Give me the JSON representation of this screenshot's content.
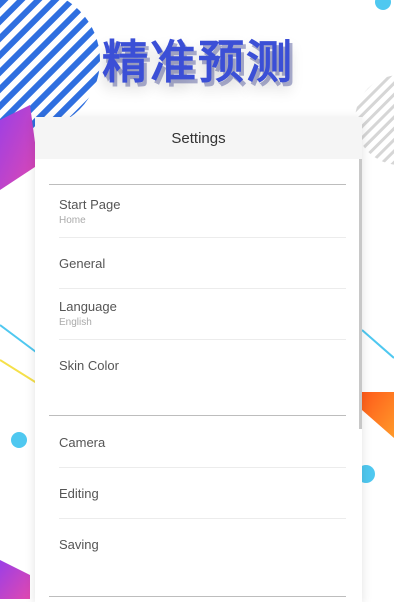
{
  "banner": {
    "title": "精准预测"
  },
  "settings": {
    "title": "Settings",
    "items": [
      {
        "label": "Start Page",
        "value": "Home"
      },
      {
        "label": "General"
      },
      {
        "label": "Language",
        "value": "English"
      },
      {
        "label": "Skin Color"
      },
      {
        "label": "Camera"
      },
      {
        "label": "Editing"
      },
      {
        "label": "Saving"
      }
    ]
  },
  "colors": {
    "banner_text": "#3b4fd6",
    "stripe_blue": "#2f6fe0",
    "accent_cyan": "#4fc8f0",
    "accent_purple": "#b04be0",
    "accent_orange": "#ff7a1a",
    "accent_yellow": "#f5e04a"
  }
}
